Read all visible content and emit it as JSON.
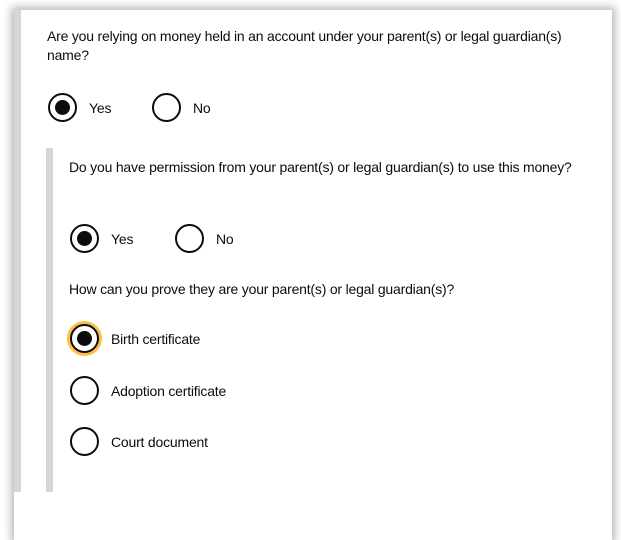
{
  "q1": {
    "text": "Are you relying on money held in an account under your parent(s) or legal guardian(s) name?",
    "options": [
      {
        "label": "Yes",
        "selected": true
      },
      {
        "label": "No",
        "selected": false
      }
    ]
  },
  "q2": {
    "text": "Do you have permission from your parent(s) or legal guardian(s) to use this money?",
    "options": [
      {
        "label": "Yes",
        "selected": true
      },
      {
        "label": "No",
        "selected": false
      }
    ]
  },
  "q3": {
    "text": "How can you prove they are your parent(s) or legal guardian(s)?",
    "options": [
      {
        "label": "Birth certificate",
        "selected": true,
        "focused": true
      },
      {
        "label": "Adoption certificate",
        "selected": false
      },
      {
        "label": "Court document",
        "selected": false
      }
    ]
  },
  "colors": {
    "focus": "#ffbf47",
    "border": "#d6d6d6",
    "text": "#0b0c0c"
  }
}
